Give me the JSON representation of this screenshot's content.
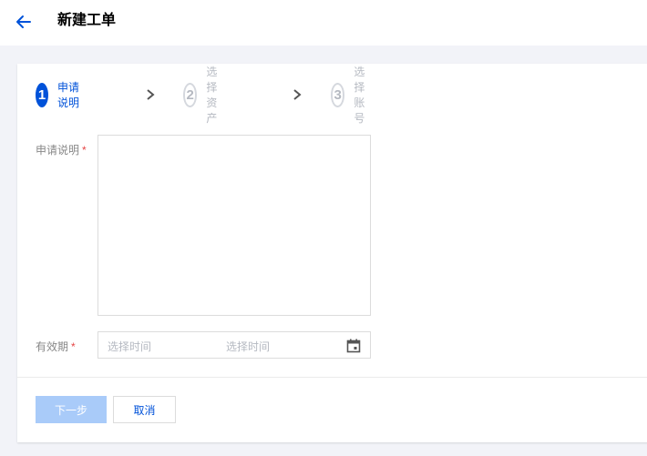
{
  "header": {
    "title": "新建工单"
  },
  "steps": [
    {
      "num": "1",
      "label": "申请说明",
      "state": "active"
    },
    {
      "num": "2",
      "label": "选择资产",
      "state": "inactive"
    },
    {
      "num": "3",
      "label": "选择账号",
      "state": "inactive"
    }
  ],
  "form": {
    "description_label": "申请说明",
    "validity_label": "有效期",
    "required_mark": "*",
    "date_start_placeholder": "选择时间",
    "date_end_placeholder": "选择时间",
    "description_value": ""
  },
  "buttons": {
    "next": "下一步",
    "cancel": "取消"
  },
  "colors": {
    "accent": "#0052d9",
    "disabled_button": "#a9cbf9",
    "required": "#e54545"
  },
  "icons": [
    "back-arrow-icon",
    "chevron-right-icon",
    "calendar-icon"
  ]
}
